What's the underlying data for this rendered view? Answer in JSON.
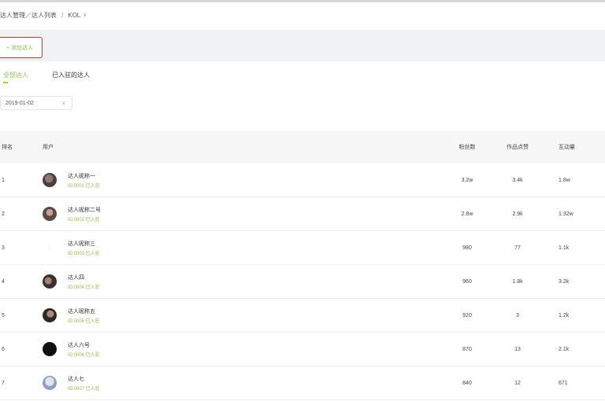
{
  "breadcrumb": {
    "root": "达人管理／达人列表",
    "current": "KOL",
    "sep": "/",
    "caret": "∨"
  },
  "header": {
    "action_button_label": "+ 添加达人"
  },
  "tabs": [
    {
      "label": "全部达人",
      "active": true
    },
    {
      "label": "已入驻的达人",
      "active": false
    }
  ],
  "filters": {
    "date_value": "2019-01-02",
    "clear_glyph": "×"
  },
  "table": {
    "columns": [
      "排名",
      "用户",
      "粉丝数",
      "作品点赞",
      "互动量"
    ],
    "rows": [
      {
        "rank": "1",
        "name": "达人昵称一",
        "sub": "ID:0001 已入驻",
        "avatar": "av-0",
        "col_a": "3.2w",
        "col_b": "3.4k",
        "col_c": "1.8w"
      },
      {
        "rank": "2",
        "name": "达人昵称二号",
        "sub": "ID:0002 已入驻",
        "avatar": "av-1",
        "col_a": "2.8w",
        "col_b": "2.9k",
        "col_c": "1.32w"
      },
      {
        "rank": "3",
        "name": "达人昵称三",
        "sub": "ID:0003 已入驻",
        "avatar": "av-2",
        "col_a": "980",
        "col_b": "77",
        "col_c": "1.1k"
      },
      {
        "rank": "4",
        "name": "达人四",
        "sub": "ID:0004 已入驻",
        "avatar": "av-3",
        "col_a": "960",
        "col_b": "1.8k",
        "col_c": "3.2k"
      },
      {
        "rank": "5",
        "name": "达人昵称五",
        "sub": "ID:0005 已入驻",
        "avatar": "av-4",
        "col_a": "920",
        "col_b": "3",
        "col_c": "1.2k"
      },
      {
        "rank": "6",
        "name": "达人六号",
        "sub": "ID:0006 已入驻",
        "avatar": "av-5",
        "col_a": "870",
        "col_b": "13",
        "col_c": "2.1k"
      },
      {
        "rank": "7",
        "name": "达人七",
        "sub": "ID:0007 已入驻",
        "avatar": "av-6",
        "col_a": "840",
        "col_b": "12",
        "col_c": "671"
      }
    ]
  }
}
